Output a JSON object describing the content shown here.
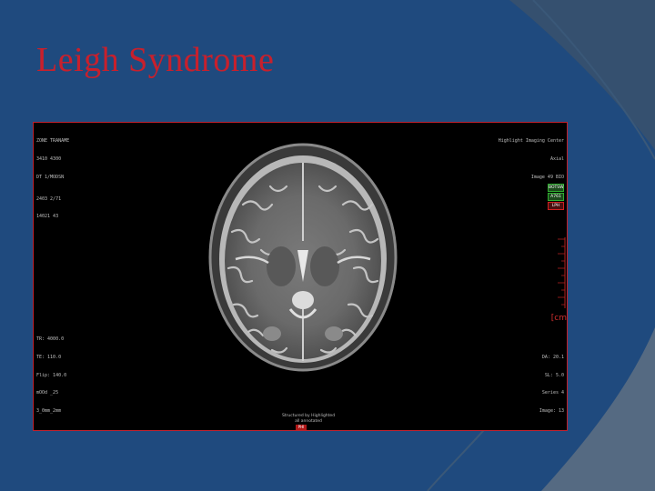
{
  "slide": {
    "title": "Leigh Syndrome"
  },
  "viewer": {
    "top_left": [
      "ZONE TRANAME",
      "3410 4300",
      "DT 1/MODSN",
      "2403 2/71",
      "14021 43"
    ],
    "top_right": [
      "Highlight Imaging Center",
      "Axial",
      "Image 49 BIO"
    ],
    "bottom_left": [
      "TR: 4000.0",
      "TE: 110.0",
      "Flip: 140.0",
      "mOOd _25",
      "3_0mm_2mm"
    ],
    "bottom_right": [
      "DA: 20.1",
      "SL: 5.0",
      "Series 4",
      "Image: 13"
    ],
    "orientation_tags": [
      {
        "label": "BOTSW",
        "color": "#2fae2f"
      },
      {
        "label": "A761",
        "color": "#2fae2f"
      },
      {
        "label": "LPH",
        "color": "#d02020"
      }
    ],
    "scale_unit": "[cm",
    "footer_lines": [
      "Structured by Highlighted",
      "all annotated"
    ],
    "footer_badge": "PHI"
  },
  "colors": {
    "background": "#1f4a7e",
    "title": "#c8202c",
    "viewer_border": "#c0202c"
  }
}
